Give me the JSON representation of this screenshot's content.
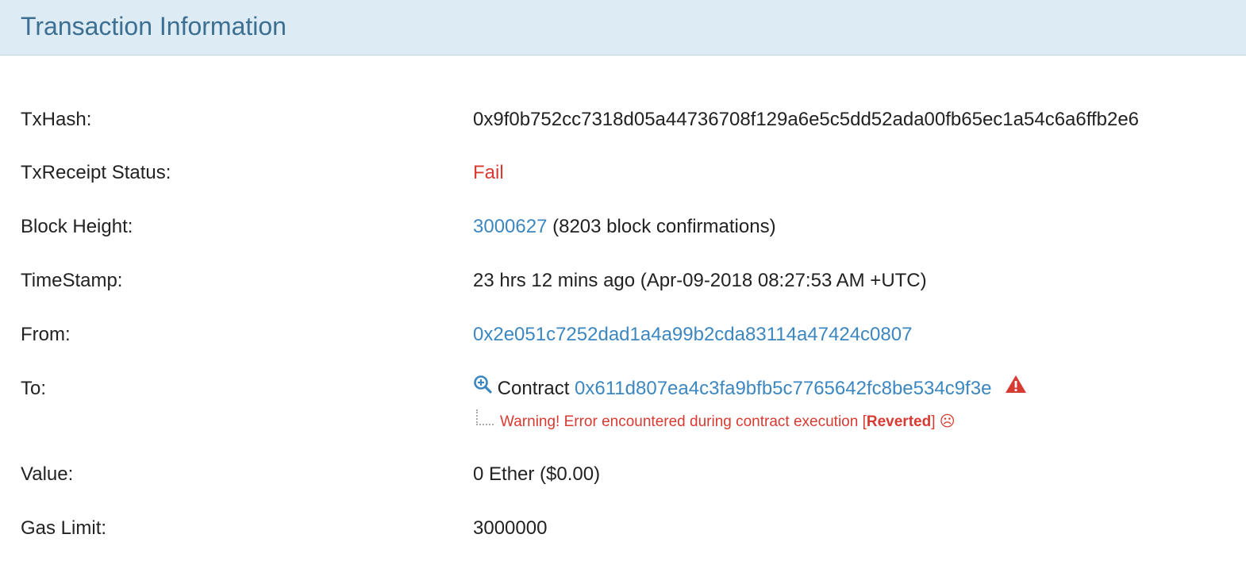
{
  "header": {
    "title": "Transaction Information"
  },
  "rows": {
    "txhash": {
      "label": "TxHash:",
      "value": "0x9f0b752cc7318d05a44736708f129a6e5c5dd52ada00fb65ec1a54c6a6ffb2e6"
    },
    "status": {
      "label": "TxReceipt Status:",
      "value": "Fail"
    },
    "block": {
      "label": "Block Height:",
      "number": "3000627",
      "confirmations": "(8203 block confirmations)"
    },
    "timestamp": {
      "label": "TimeStamp:",
      "value": "23 hrs 12 mins ago (Apr-09-2018 08:27:53 AM +UTC)"
    },
    "from": {
      "label": "From:",
      "value": "0x2e051c7252dad1a4a99b2cda83114a47424c0807"
    },
    "to": {
      "label": "To:",
      "prefix": "Contract",
      "address": "0x611d807ea4c3fa9bfb5c7765642fc8be534c9f3e",
      "warning_text": "Warning! Error encountered during contract execution [",
      "warning_reverted": "Reverted",
      "warning_suffix": "] ☹"
    },
    "value": {
      "label": "Value:",
      "value": "0 Ether ($0.00)"
    },
    "gaslimit": {
      "label": "Gas Limit:",
      "value": "3000000"
    }
  },
  "colors": {
    "link": "#3d87c0",
    "fail": "#d63a31",
    "header_bg": "#dcebf4",
    "header_text": "#3c6f91"
  },
  "icons": [
    "zoom-in-icon",
    "warning-triangle-icon",
    "sad-face-icon"
  ]
}
